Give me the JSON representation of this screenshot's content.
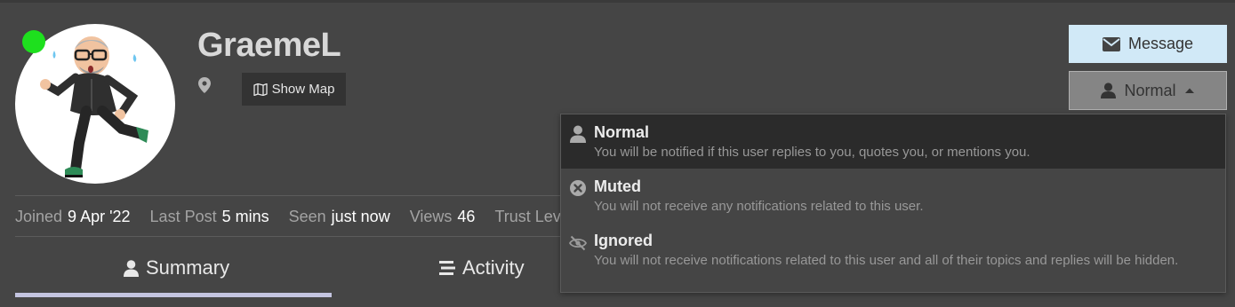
{
  "user": {
    "username": "GraemeL",
    "online_color": "#1ee01e",
    "avatar_icon": "bitmoji-running-avatar",
    "location_icon": "map-marker-icon"
  },
  "actions": {
    "show_map_label": "Show Map",
    "message_label": "Message",
    "notification_level_label": "Normal"
  },
  "stats": [
    {
      "label": "Joined",
      "value": "9 Apr '22"
    },
    {
      "label": "Last Post",
      "value": "5 mins"
    },
    {
      "label": "Seen",
      "value": "just now"
    },
    {
      "label": "Views",
      "value": "46"
    },
    {
      "label": "Trust Level",
      "value": ""
    }
  ],
  "tabs": [
    {
      "label": "Summary",
      "active": true
    },
    {
      "label": "Activity",
      "active": false
    }
  ],
  "notification_menu": [
    {
      "title": "Normal",
      "icon": "user-icon",
      "description": "You will be notified if this user replies to you, quotes you, or mentions you.",
      "selected": true
    },
    {
      "title": "Muted",
      "icon": "times-circle-icon",
      "description": "You will not receive any notifications related to this user.",
      "selected": false
    },
    {
      "title": "Ignored",
      "icon": "eye-slash-icon",
      "description": "You will not receive notifications related to this user and all of their topics and replies will be hidden.",
      "selected": false
    }
  ],
  "colors": {
    "background": "#454545",
    "message_button": "#d1e9f7",
    "tab_underline": "#c3c4e0"
  }
}
